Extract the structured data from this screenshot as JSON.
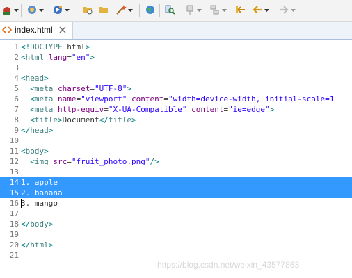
{
  "toolbar": {
    "icons": [
      "debug-icon",
      "new-icon",
      "run-icon",
      "open-folder-icon",
      "open-file-icon",
      "wand-icon",
      "globe-icon",
      "search-icon",
      "pin-icon",
      "hierarchy-icon",
      "prev-annotation-icon",
      "back-icon",
      "forward-icon"
    ]
  },
  "tab": {
    "label": "index.html"
  },
  "editor": {
    "lines": [
      {
        "n": "1",
        "tokens": [
          {
            "c": "p",
            "t": "<!"
          },
          {
            "c": "t",
            "t": "DOCTYPE"
          },
          {
            "c": "txt",
            "t": " html"
          },
          {
            "c": "p",
            "t": ">"
          }
        ]
      },
      {
        "n": "2",
        "tokens": [
          {
            "c": "p",
            "t": "<"
          },
          {
            "c": "t",
            "t": "html"
          },
          {
            "c": "txt",
            "t": " "
          },
          {
            "c": "a",
            "t": "lang"
          },
          {
            "c": "txt",
            "t": "="
          },
          {
            "c": "v",
            "t": "\"en\""
          },
          {
            "c": "p",
            "t": ">"
          }
        ]
      },
      {
        "n": "3",
        "tokens": []
      },
      {
        "n": "4",
        "tokens": [
          {
            "c": "p",
            "t": "<"
          },
          {
            "c": "t",
            "t": "head"
          },
          {
            "c": "p",
            "t": ">"
          }
        ]
      },
      {
        "n": "5",
        "tokens": [
          {
            "c": "txt",
            "t": "  "
          },
          {
            "c": "p",
            "t": "<"
          },
          {
            "c": "t",
            "t": "meta"
          },
          {
            "c": "txt",
            "t": " "
          },
          {
            "c": "a",
            "t": "charset"
          },
          {
            "c": "txt",
            "t": "="
          },
          {
            "c": "v",
            "t": "\"UTF-8\""
          },
          {
            "c": "p",
            "t": ">"
          }
        ]
      },
      {
        "n": "6",
        "tokens": [
          {
            "c": "txt",
            "t": "  "
          },
          {
            "c": "p",
            "t": "<"
          },
          {
            "c": "t",
            "t": "meta"
          },
          {
            "c": "txt",
            "t": " "
          },
          {
            "c": "a",
            "t": "name"
          },
          {
            "c": "txt",
            "t": "="
          },
          {
            "c": "v",
            "t": "\"viewport\""
          },
          {
            "c": "txt",
            "t": " "
          },
          {
            "c": "a",
            "t": "content"
          },
          {
            "c": "txt",
            "t": "="
          },
          {
            "c": "v",
            "t": "\"width=device-width, initial-scale=1"
          }
        ]
      },
      {
        "n": "7",
        "tokens": [
          {
            "c": "txt",
            "t": "  "
          },
          {
            "c": "p",
            "t": "<"
          },
          {
            "c": "t",
            "t": "meta"
          },
          {
            "c": "txt",
            "t": " "
          },
          {
            "c": "a",
            "t": "http-equiv"
          },
          {
            "c": "txt",
            "t": "="
          },
          {
            "c": "v",
            "t": "\"X-UA-Compatible\""
          },
          {
            "c": "txt",
            "t": " "
          },
          {
            "c": "a",
            "t": "content"
          },
          {
            "c": "txt",
            "t": "="
          },
          {
            "c": "v",
            "t": "\"ie=edge\""
          },
          {
            "c": "p",
            "t": ">"
          }
        ]
      },
      {
        "n": "8",
        "tokens": [
          {
            "c": "txt",
            "t": "  "
          },
          {
            "c": "p",
            "t": "<"
          },
          {
            "c": "t",
            "t": "title"
          },
          {
            "c": "p",
            "t": ">"
          },
          {
            "c": "txt",
            "t": "Document"
          },
          {
            "c": "p",
            "t": "</"
          },
          {
            "c": "t",
            "t": "title"
          },
          {
            "c": "p",
            "t": ">"
          }
        ]
      },
      {
        "n": "9",
        "tokens": [
          {
            "c": "p",
            "t": "</"
          },
          {
            "c": "t",
            "t": "head"
          },
          {
            "c": "p",
            "t": ">"
          }
        ]
      },
      {
        "n": "10",
        "tokens": []
      },
      {
        "n": "11",
        "tokens": [
          {
            "c": "p",
            "t": "<"
          },
          {
            "c": "t",
            "t": "body"
          },
          {
            "c": "p",
            "t": ">"
          }
        ]
      },
      {
        "n": "12",
        "tokens": [
          {
            "c": "txt",
            "t": "  "
          },
          {
            "c": "p",
            "t": "<"
          },
          {
            "c": "t",
            "t": "img"
          },
          {
            "c": "txt",
            "t": " "
          },
          {
            "c": "a",
            "t": "src"
          },
          {
            "c": "txt",
            "t": "="
          },
          {
            "c": "v",
            "t": "\"fruit_photo.png\""
          },
          {
            "c": "p",
            "t": "/>"
          }
        ]
      },
      {
        "n": "13",
        "tokens": []
      },
      {
        "n": "14",
        "sel": true,
        "tokens": [
          {
            "c": "txt",
            "t": "1. apple"
          }
        ]
      },
      {
        "n": "15",
        "sel": true,
        "tokens": [
          {
            "c": "txt",
            "t": "2. banana"
          }
        ]
      },
      {
        "n": "16",
        "caret": true,
        "tokens": [
          {
            "c": "txt",
            "t": "3. mango"
          }
        ]
      },
      {
        "n": "17",
        "tokens": []
      },
      {
        "n": "18",
        "tokens": [
          {
            "c": "p",
            "t": "</"
          },
          {
            "c": "t",
            "t": "body"
          },
          {
            "c": "p",
            "t": ">"
          }
        ]
      },
      {
        "n": "19",
        "tokens": []
      },
      {
        "n": "20",
        "tokens": [
          {
            "c": "p",
            "t": "</"
          },
          {
            "c": "t",
            "t": "html"
          },
          {
            "c": "p",
            "t": ">"
          }
        ]
      },
      {
        "n": "21",
        "tokens": []
      }
    ]
  },
  "watermark": "https://blog.csdn.net/weixin_43577863"
}
